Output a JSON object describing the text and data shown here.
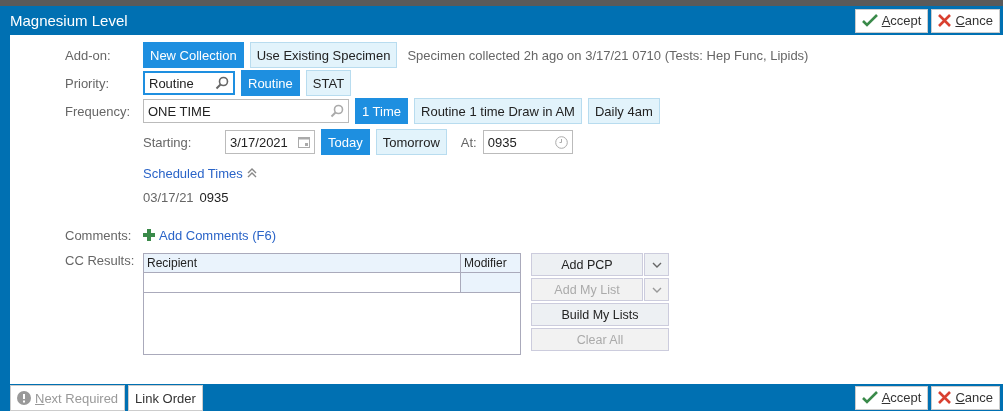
{
  "window": {
    "title": "Magnesium Level"
  },
  "header_actions": [
    {
      "kind": "accept",
      "label": "Accept"
    },
    {
      "kind": "cancel",
      "label": "Cance"
    }
  ],
  "add_on": {
    "label": "Add-on:",
    "options": [
      {
        "label": "New Collection",
        "selected": true
      },
      {
        "label": "Use Existing Specimen",
        "selected": false
      }
    ],
    "note": "Specimen collected 2h ago on 3/17/21 0710 (Tests: Hep Func, Lipids)"
  },
  "priority": {
    "label": "Priority:",
    "value": "Routine",
    "focused": true,
    "options": [
      {
        "label": "Routine",
        "selected": true
      },
      {
        "label": "STAT",
        "selected": false
      }
    ]
  },
  "frequency": {
    "label": "Frequency:",
    "value": "ONE TIME",
    "focused": false,
    "options": [
      {
        "label": "1 Time",
        "selected": true
      },
      {
        "label": "Routine 1 time Draw in AM",
        "selected": false
      },
      {
        "label": "Daily 4am",
        "selected": false
      }
    ]
  },
  "starting": {
    "label": "Starting:",
    "value": "3/17/2021",
    "options": [
      {
        "label": "Today",
        "selected": true
      },
      {
        "label": "Tomorrow",
        "selected": false
      }
    ],
    "at_label": "At:",
    "at_value": "0935"
  },
  "scheduled_times": {
    "link": "Scheduled Times",
    "expanded": true,
    "entries": [
      {
        "date": "03/17/21",
        "time": "0935"
      }
    ]
  },
  "comments": {
    "label": "Comments:",
    "link": "Add Comments (F6)"
  },
  "cc_results": {
    "label": "CC Results:",
    "columns": [
      "Recipient",
      "Modifier"
    ],
    "buttons": [
      {
        "label": "Add PCP",
        "disabled": false,
        "dropdown": true
      },
      {
        "label": "Add My List",
        "disabled": true,
        "dropdown": true
      },
      {
        "label": "Build My Lists",
        "disabled": false,
        "dropdown": false
      },
      {
        "label": "Clear All",
        "disabled": true,
        "dropdown": false
      }
    ]
  },
  "footer": {
    "buttons": [
      {
        "kind": "next",
        "label": "Next Required",
        "disabled": true
      },
      {
        "kind": "plain",
        "label": "Link Order",
        "disabled": false
      }
    ],
    "actions": [
      {
        "kind": "accept",
        "label": "Accept"
      },
      {
        "kind": "cancel",
        "label": "Cance"
      }
    ]
  }
}
